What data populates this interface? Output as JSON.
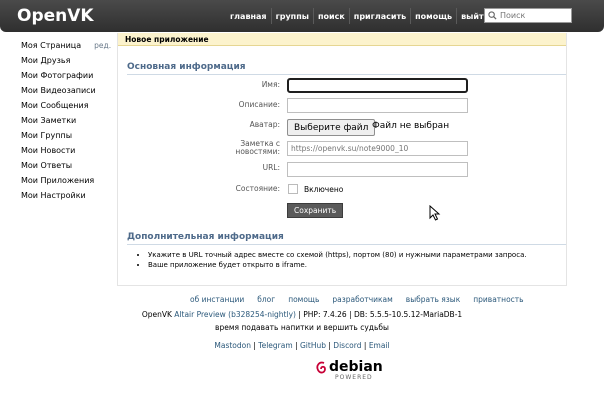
{
  "header": {
    "logo": "OpenVK",
    "nav": [
      "главная",
      "группы",
      "поиск",
      "пригласить",
      "помощь",
      "выйти"
    ],
    "search_placeholder": "Поиск"
  },
  "sidebar": {
    "items": [
      {
        "label": "Моя Страница",
        "edit": "ред."
      },
      {
        "label": "Мои Друзья"
      },
      {
        "label": "Мои Фотографии"
      },
      {
        "label": "Мои Видеозаписи"
      },
      {
        "label": "Мои Сообщения"
      },
      {
        "label": "Мои Заметки"
      },
      {
        "label": "Мои Группы"
      },
      {
        "label": "Мои Новости"
      },
      {
        "label": "Мои Ответы"
      },
      {
        "label": "Мои Приложения"
      },
      {
        "label": "Мои Настройки"
      }
    ]
  },
  "page": {
    "header": "Новое приложение",
    "section_main": "Основная информация",
    "fields": {
      "name_label": "Имя:",
      "name_value": "",
      "description_label": "Описание:",
      "description_value": "",
      "avatar_label": "Аватар:",
      "file_button": "Выберите файл",
      "file_status": "Файл не выбран",
      "note_label_1": "Заметка с",
      "note_label_2": "новостями:",
      "note_placeholder": "https://openvk.su/note9000_10",
      "url_label": "URL:",
      "url_value": "",
      "state_label": "Состояние:",
      "state_checkbox": "Включено",
      "state_checked": false
    },
    "save_button": "Сохранить",
    "section_extra": "Дополнительная информация",
    "info": [
      "Укажите в URL точный адрес вместе со схемой (https), портом (80) и нужными параметрами запроса.",
      "Ваше приложение будет открыто в iframe."
    ]
  },
  "footer": {
    "links": [
      "об инстанции",
      "блог",
      "помощь",
      "разработчикам",
      "выбрать язык",
      "приватность"
    ],
    "version_prefix": "OpenVK",
    "version_link": "Altair Preview (b328254-nightly)",
    "version_suffix": "| PHP: 7.4.26 | DB: 5.5.5-10.5.12-MariaDB-1",
    "motto": "время подавать напитки и вершить судьбы",
    "social": [
      "Mastodon",
      "Telegram",
      "GitHub",
      "Discord",
      "Email"
    ],
    "debian": "debian",
    "debian_powered": "POWERED"
  },
  "colors": {
    "header_bg": "#3c3c3c",
    "page_header_bg": "#fcf3cd",
    "section_title": "#4e6a8a",
    "link": "#2b587a",
    "debian_swirl": "#c70036"
  }
}
